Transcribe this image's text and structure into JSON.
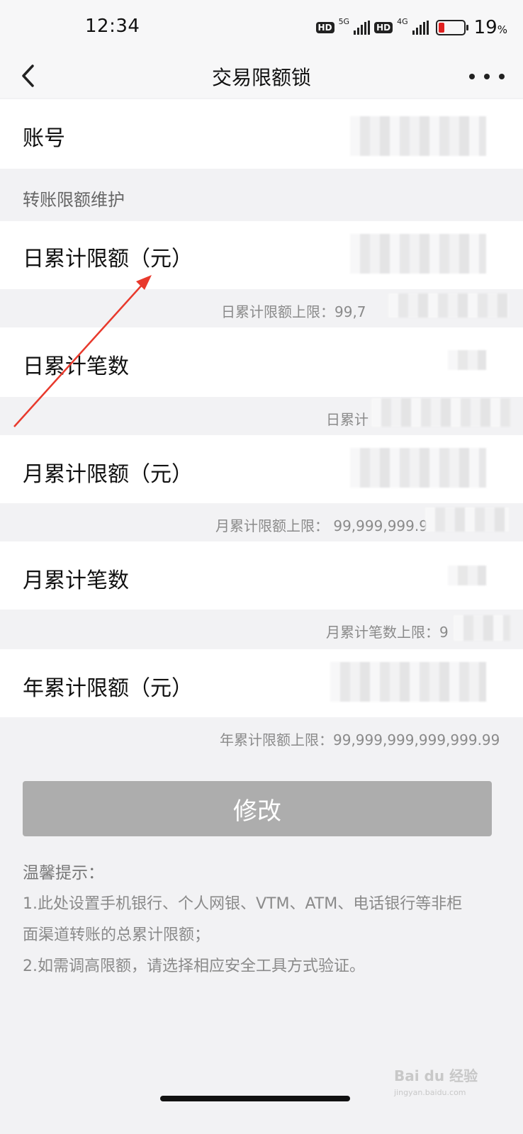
{
  "status_bar": {
    "time": "12:34",
    "hd1": "HD",
    "network1": "5G",
    "hd2": "HD",
    "network2": "4G",
    "battery_percent": "19",
    "battery_percent_sign": "%"
  },
  "nav": {
    "title": "交易限额锁",
    "back_icon": "chevron-left-icon",
    "more_icon": "more-dots-icon"
  },
  "account": {
    "label": "账号"
  },
  "section_title": "转账限额维护",
  "rows": {
    "daily_amount": {
      "label": "日累计限额（元）",
      "hint": "日累计限额上限：99,7"
    },
    "daily_count": {
      "label": "日累计笔数",
      "hint": "日累计"
    },
    "monthly_amount": {
      "label": "月累计限额（元）",
      "hint": "月累计限额上限：   99,999,999.9"
    },
    "monthly_count": {
      "label": "月累计笔数",
      "hint": "月累计笔数上限：9"
    },
    "yearly_amount": {
      "label": "年累计限额（元）",
      "hint": "年累计限额上限：99,999,999,999,999.99"
    }
  },
  "submit_button": "修改",
  "tips": {
    "title": "温馨提示：",
    "line1a": "1.此处设置手机银行、个人网银、VTM、ATM、电话银行等非柜",
    "line1b": "面渠道转账的总累计限额；",
    "line2": "2.如需调高限额，请选择相应安全工具方式验证。"
  },
  "watermark": {
    "brand": "Bai du 经验",
    "url": "jingyan.baidu.com"
  },
  "colors": {
    "background": "#f2f2f4",
    "card": "#ffffff",
    "button_disabled": "#adadad",
    "annotation_arrow": "#e8392c",
    "battery_low": "#e02020"
  }
}
